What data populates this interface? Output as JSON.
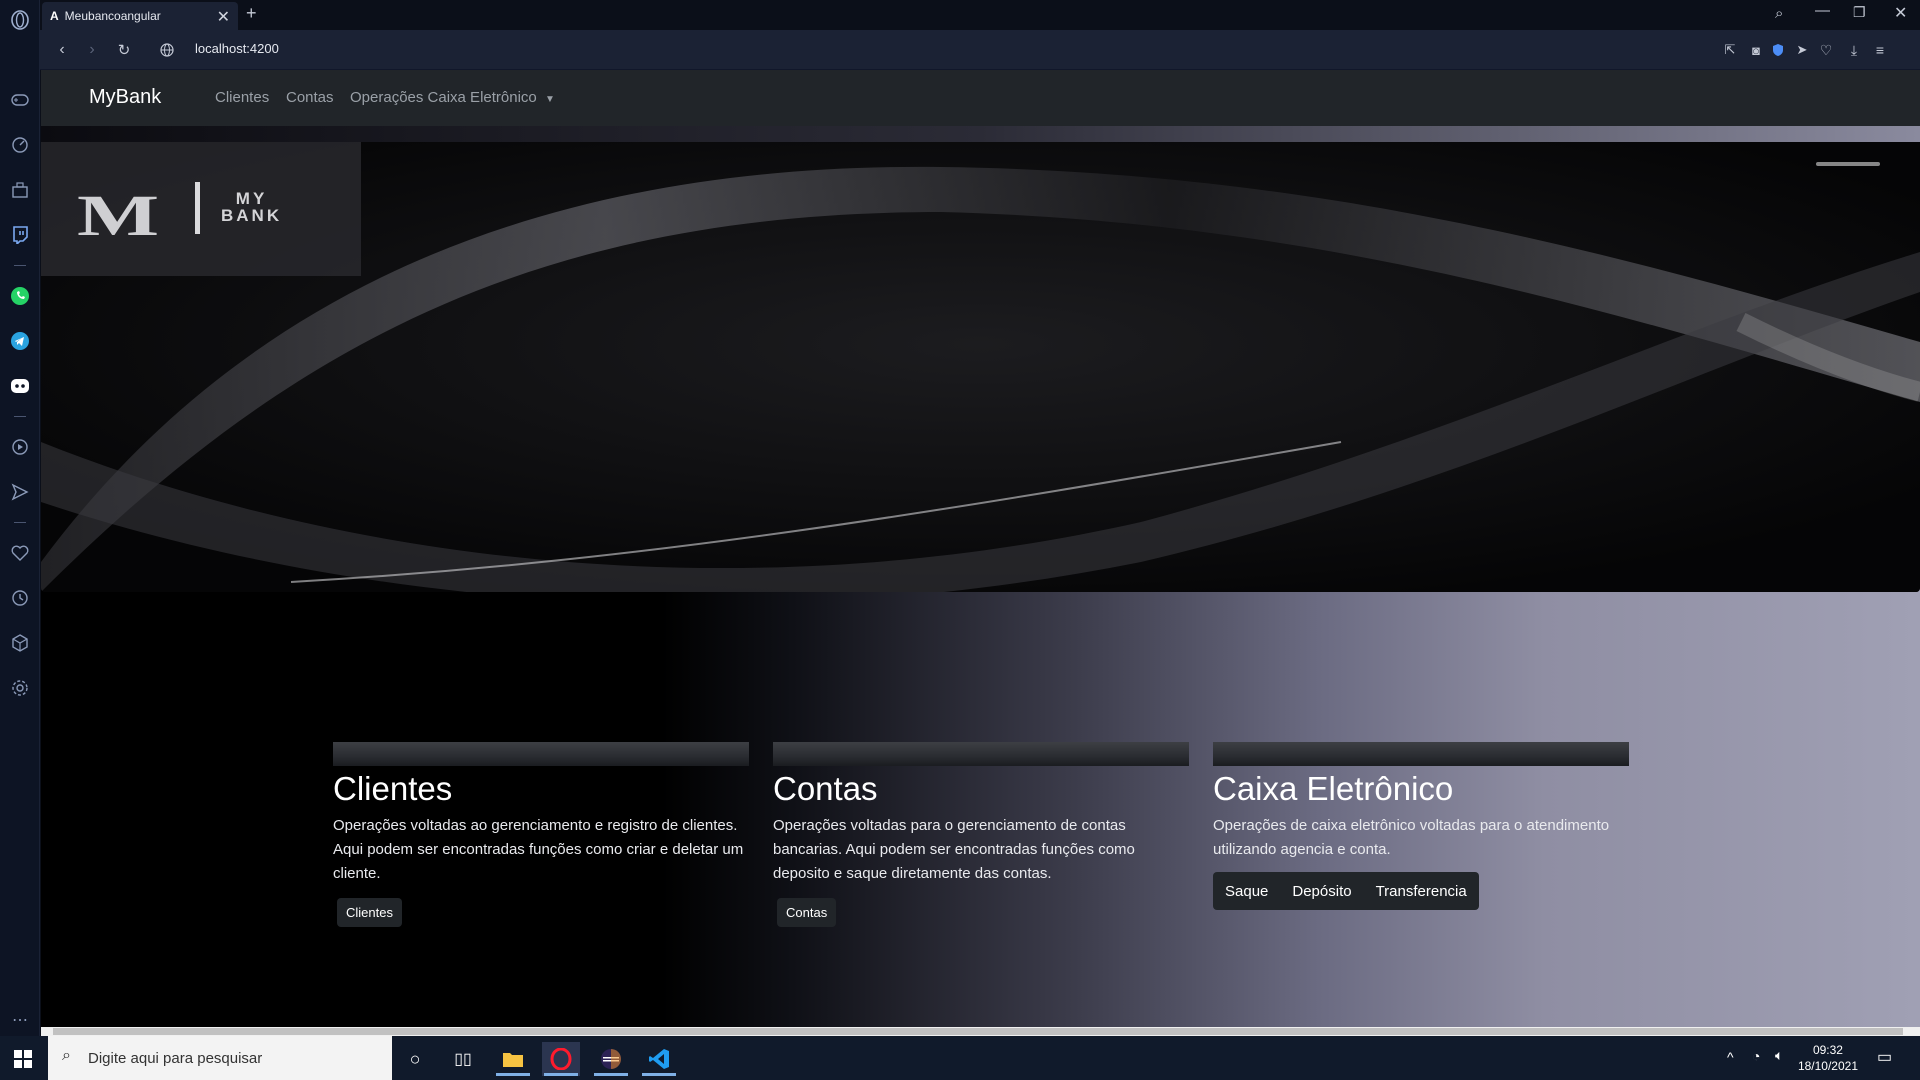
{
  "browser": {
    "tab_title": "Meubancoangular",
    "url": "localhost:4200"
  },
  "navbar": {
    "brand": "MyBank",
    "links": [
      "Clientes",
      "Contas",
      "Operações Caixa Eletrônico"
    ]
  },
  "hero": {
    "logo_letter": "M",
    "logo_text_line1": "MY",
    "logo_text_line2": "BANK"
  },
  "cards": [
    {
      "title": "Clientes",
      "description": "Operações voltadas ao gerenciamento e registro de clientes. Aqui podem ser encontradas funções como criar e deletar um cliente.",
      "button": "Clientes"
    },
    {
      "title": "Contas",
      "description": "Operações voltadas para o gerenciamento de contas bancarias. Aqui podem ser encontradas funções como deposito e saque diretamente das contas.",
      "button": "Contas"
    },
    {
      "title": "Caixa Eletrônico",
      "description": "Operações de caixa eletrônico voltadas para o atendimento utilizando agencia e conta.",
      "buttons": [
        "Saque",
        "Depósito",
        "Transferencia"
      ]
    }
  ],
  "taskbar": {
    "search_placeholder": "Digite aqui para pesquisar",
    "time": "09:32",
    "date": "18/10/2021"
  }
}
